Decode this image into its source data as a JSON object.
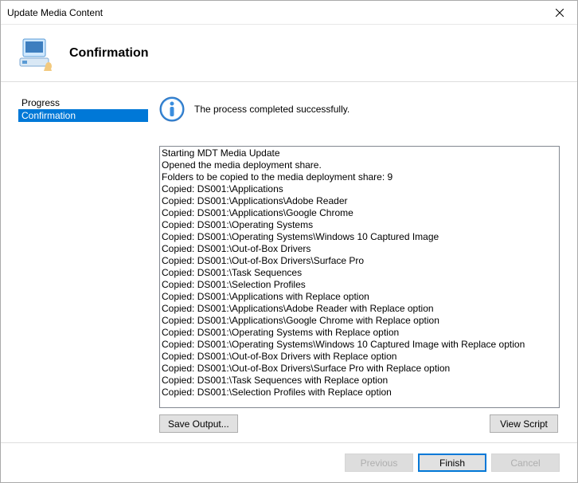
{
  "window": {
    "title": "Update Media Content"
  },
  "header": {
    "title": "Confirmation"
  },
  "sidebar": {
    "items": [
      {
        "label": "Progress",
        "selected": false
      },
      {
        "label": "Confirmation",
        "selected": true
      }
    ]
  },
  "status": {
    "message": "The process completed successfully."
  },
  "log": [
    "Starting MDT Media Update",
    "Opened the media deployment share.",
    "Folders to be copied to the media deployment share: 9",
    "Copied: DS001:\\Applications",
    "Copied: DS001:\\Applications\\Adobe Reader",
    "Copied: DS001:\\Applications\\Google Chrome",
    "Copied: DS001:\\Operating Systems",
    "Copied: DS001:\\Operating Systems\\Windows 10 Captured Image",
    "Copied: DS001:\\Out-of-Box Drivers",
    "Copied: DS001:\\Out-of-Box Drivers\\Surface Pro",
    "Copied: DS001:\\Task Sequences",
    "Copied: DS001:\\Selection Profiles",
    "Copied: DS001:\\Applications with Replace option",
    "Copied: DS001:\\Applications\\Adobe Reader with Replace option",
    "Copied: DS001:\\Applications\\Google Chrome with Replace option",
    "Copied: DS001:\\Operating Systems with Replace option",
    "Copied: DS001:\\Operating Systems\\Windows 10 Captured Image with Replace option",
    "Copied: DS001:\\Out-of-Box Drivers with Replace option",
    "Copied: DS001:\\Out-of-Box Drivers\\Surface Pro with Replace option",
    "Copied: DS001:\\Task Sequences with Replace option",
    "Copied: DS001:\\Selection Profiles with Replace option"
  ],
  "buttons": {
    "save_output": "Save Output...",
    "view_script": "View Script",
    "previous": "Previous",
    "finish": "Finish",
    "cancel": "Cancel"
  }
}
